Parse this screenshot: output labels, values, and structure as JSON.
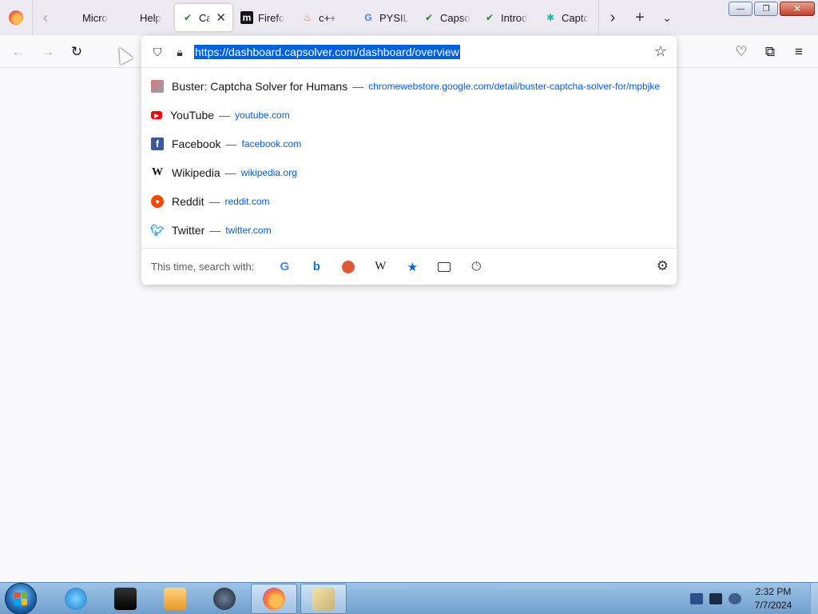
{
  "tabs": [
    {
      "label": "Micro",
      "icon": "microsoft-icon",
      "active": false
    },
    {
      "label": "Help",
      "icon": "microsoft-icon",
      "active": false
    },
    {
      "label": "Ca",
      "icon": "capsolver-icon",
      "active": true
    },
    {
      "label": "Firefo",
      "icon": "m-icon",
      "active": false
    },
    {
      "label": "c++",
      "icon": "cpp-icon",
      "active": false
    },
    {
      "label": "PYSIL",
      "icon": "google-icon",
      "active": false
    },
    {
      "label": "Capso",
      "icon": "capsolver-icon",
      "active": false
    },
    {
      "label": "Introd",
      "icon": "capsolver-icon",
      "active": false
    },
    {
      "label": "Captc",
      "icon": "puzzle-icon",
      "active": false
    }
  ],
  "window_controls": {
    "minimize": "—",
    "restore": "❐",
    "close": "✕"
  },
  "urlbar": {
    "url": "https://dashboard.capsolver.com/dashboard/overview"
  },
  "suggestions": [
    {
      "title": "Buster: Captcha Solver for Humans",
      "url": "chromewebstore.google.com/detail/buster-captcha-solver-for/mpbjke",
      "icon": "buster-icon"
    },
    {
      "title": "YouTube",
      "url": "youtube.com",
      "icon": "youtube-icon"
    },
    {
      "title": "Facebook",
      "url": "facebook.com",
      "icon": "facebook-icon"
    },
    {
      "title": "Wikipedia",
      "url": "wikipedia.org",
      "icon": "wikipedia-icon"
    },
    {
      "title": "Reddit",
      "url": "reddit.com",
      "icon": "reddit-icon"
    },
    {
      "title": "Twitter",
      "url": "twitter.com",
      "icon": "twitter-icon"
    }
  ],
  "separator": "—",
  "search_with": {
    "label": "This time, search with:",
    "engines": [
      "google-icon",
      "bing-icon",
      "duckduckgo-icon",
      "wikipedia-icon",
      "bookmarks-icon",
      "tabs-icon",
      "history-icon"
    ]
  },
  "taskbar": {
    "apps": [
      "internet-explorer-icon",
      "terminal-icon",
      "media-player-icon",
      "globe-icon",
      "firefox-icon",
      "paint-icon"
    ],
    "time": "2:32 PM",
    "date": "7/7/2024"
  },
  "colors": {
    "accent": "#0061e0",
    "link": "#0061e0",
    "tabstrip_bg": "#eceaf0",
    "page_bg": "#f9f9fb",
    "taskbar_top": "#9ec3e6"
  }
}
